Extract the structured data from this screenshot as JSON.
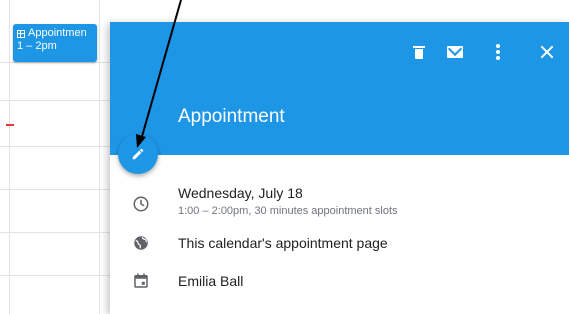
{
  "calendar": {
    "event_chip": {
      "title": "Appointmen",
      "time": "1 – 2pm"
    }
  },
  "popup": {
    "header_color": "#1e96e6",
    "actions": [
      {
        "icon": "trash-icon",
        "label": "Delete"
      },
      {
        "icon": "mail-icon",
        "label": "Email"
      },
      {
        "icon": "more-vert-icon",
        "label": "More options"
      },
      {
        "icon": "close-icon",
        "label": "Close"
      }
    ],
    "title": "Appointment",
    "edit_icon": "pencil-icon",
    "date": "Wednesday, July 18",
    "time_detail": "1:00 – 2:00pm, 30 minutes appointment slots",
    "booking_page_link": "This calendar's appointment page",
    "calendar_owner": "Emilia Ball"
  },
  "annotation": {
    "arrow_color": "#000000"
  }
}
